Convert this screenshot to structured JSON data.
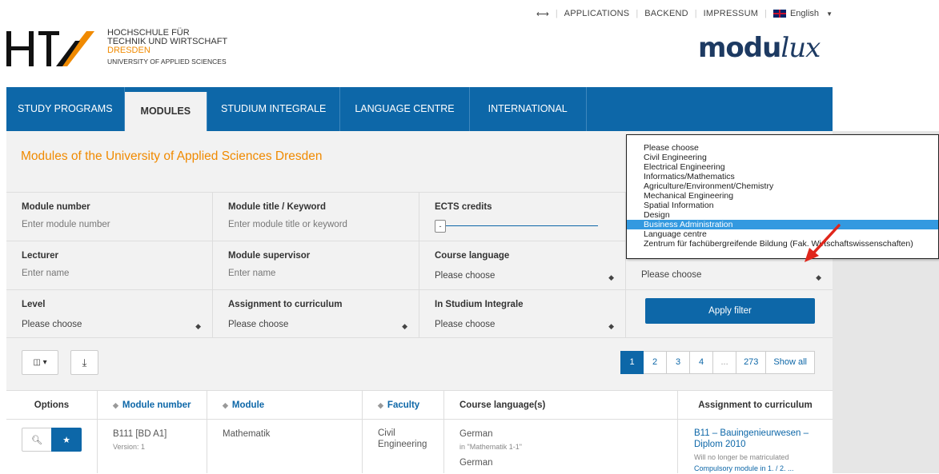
{
  "topbar": {
    "arrows": "⟷",
    "items": [
      "APPLICATIONS",
      "BACKEND",
      "IMPRESSUM"
    ],
    "language": "English"
  },
  "logo": {
    "line1": "HOCHSCHULE FÜR",
    "line2": "TECHNIK UND WIRTSCHAFT",
    "line3": "DRESDEN",
    "line4": "UNIVERSITY OF APPLIED SCIENCES"
  },
  "brand": {
    "part1": "modu",
    "part2": "lux"
  },
  "nav": [
    "STUDY PROGRAMS",
    "MODULES",
    "STUDIUM INTEGRALE",
    "LANGUAGE CENTRE",
    "INTERNATIONAL"
  ],
  "page_title": "Modules of the University of Applied Sciences Dresden",
  "filters": {
    "module_number": {
      "label": "Module number",
      "placeholder": "Enter module number"
    },
    "module_title": {
      "label": "Module title / Keyword",
      "placeholder": "Enter module title or keyword"
    },
    "ects": {
      "label": "ECTS credits",
      "handle": "-"
    },
    "lecturer": {
      "label": "Lecturer",
      "placeholder": "Enter name"
    },
    "supervisor": {
      "label": "Module supervisor",
      "placeholder": "Enter name"
    },
    "course_language": {
      "label": "Course language",
      "value": "Please choose"
    },
    "faculty": {
      "value": "Please choose"
    },
    "level": {
      "label": "Level",
      "value": "Please choose"
    },
    "curriculum": {
      "label": "Assignment to curriculum",
      "value": "Please choose"
    },
    "studium": {
      "label": "In Studium Integrale",
      "value": "Please choose"
    },
    "apply": "Apply filter"
  },
  "toolbar": {
    "columns_icon": "◫ ▾",
    "download_icon": "⤓"
  },
  "pager": [
    "1",
    "2",
    "3",
    "4",
    "...",
    "273",
    "Show all"
  ],
  "table": {
    "headers": [
      "Options",
      "Module number",
      "Module",
      "Faculty",
      "Course language(s)",
      "Assignment to curriculum"
    ],
    "row": {
      "number": "B111 [BD A1]",
      "version": "Version: 1",
      "module": "Mathematik",
      "faculty": "Civil Engineering",
      "lang1": "German",
      "lang_note": "in \"Mathematik 1-1\"",
      "lang2": "German",
      "curriculum": "B11 – Bauingenieurwesen – Diplom 2010",
      "cur_note": "Will no longer be matriculated",
      "cur_more": "Compulsory module in 1. / 2. ..."
    }
  },
  "dropdown": {
    "options": [
      "Please choose",
      "Civil Engineering",
      "Electrical Engineering",
      "Informatics/Mathematics",
      "Agriculture/Environment/Chemistry",
      "Mechanical Engineering",
      "Spatial Information",
      "Design",
      "Business Administration",
      "Language centre",
      "Zentrum für fachübergreifende Bildung (Fak. Wirtschaftswissenschaften)"
    ],
    "selected": "Business Administration"
  },
  "colors": {
    "primary": "#0d67a8",
    "accent": "#f08a00",
    "arrow": "#e0261b"
  }
}
